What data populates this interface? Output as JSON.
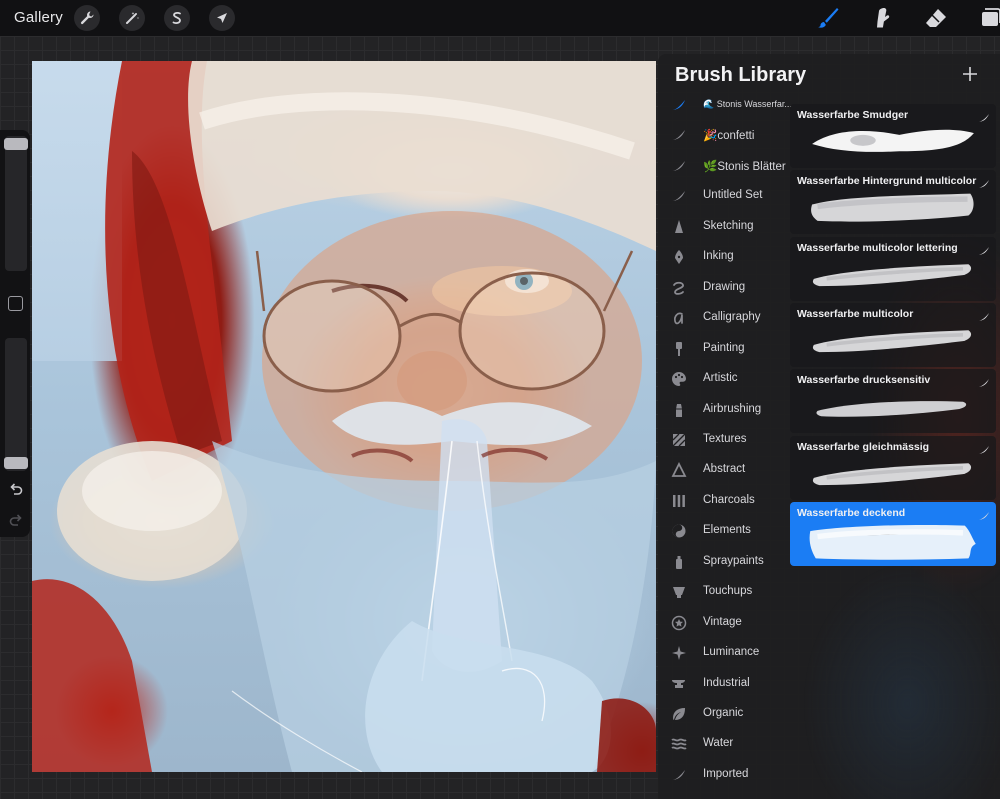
{
  "topbar": {
    "gallery_label": "Gallery",
    "left_tools": [
      {
        "name": "actions",
        "icon": "wrench-icon"
      },
      {
        "name": "adjustments",
        "icon": "magic-wand-icon"
      },
      {
        "name": "selection",
        "icon": "selection-s-icon"
      },
      {
        "name": "transform",
        "icon": "arrow-cursor-icon"
      }
    ],
    "right_tools": [
      {
        "name": "brush",
        "icon": "brush-icon",
        "active": true
      },
      {
        "name": "smudge",
        "icon": "smudge-finger-icon"
      },
      {
        "name": "eraser",
        "icon": "eraser-icon"
      },
      {
        "name": "layers",
        "icon": "layers-icon"
      }
    ],
    "accent_color": "#1b7df4"
  },
  "sidebar": {
    "size_slider_level": 0.02,
    "opacity_slider_level": 0.98,
    "modify_icon": "square-icon",
    "undo_icon": "undo-arrow-icon",
    "redo_icon": "redo-arrow-icon"
  },
  "panel": {
    "title": "Brush Library",
    "add_icon": "plus-icon",
    "sets": [
      {
        "label": "🌊 Stonis Wasserfar...",
        "icon": "brush-stroke-icon",
        "selected": true,
        "small": true
      },
      {
        "label": "🎉confetti",
        "icon": "brush-stroke-icon"
      },
      {
        "label": "🌿Stonis Blätter",
        "icon": "brush-stroke-icon"
      },
      {
        "label": "Untitled Set",
        "icon": "brush-stroke-icon"
      },
      {
        "label": "Sketching",
        "icon": "pencil-tip-icon"
      },
      {
        "label": "Inking",
        "icon": "ink-nib-icon"
      },
      {
        "label": "Drawing",
        "icon": "squiggle-icon"
      },
      {
        "label": "Calligraphy",
        "icon": "calligraphy-a-icon"
      },
      {
        "label": "Painting",
        "icon": "paint-brush-icon"
      },
      {
        "label": "Artistic",
        "icon": "palette-icon"
      },
      {
        "label": "Airbrushing",
        "icon": "airbrush-icon"
      },
      {
        "label": "Textures",
        "icon": "hatch-texture-icon"
      },
      {
        "label": "Abstract",
        "icon": "triangle-icon"
      },
      {
        "label": "Charcoals",
        "icon": "charcoal-bars-icon"
      },
      {
        "label": "Elements",
        "icon": "yin-yang-icon"
      },
      {
        "label": "Spraypaints",
        "icon": "spray-can-icon"
      },
      {
        "label": "Touchups",
        "icon": "touchup-cup-icon"
      },
      {
        "label": "Vintage",
        "icon": "star-circle-icon"
      },
      {
        "label": "Luminance",
        "icon": "sparkle-icon"
      },
      {
        "label": "Industrial",
        "icon": "anvil-icon"
      },
      {
        "label": "Organic",
        "icon": "leaf-icon"
      },
      {
        "label": "Water",
        "icon": "waves-icon"
      },
      {
        "label": "Imported",
        "icon": "brush-stroke-icon"
      }
    ],
    "brushes": [
      {
        "name": "Wasserfarbe Smudger",
        "selected": false,
        "stroke": "smudger"
      },
      {
        "name": "Wasserfarbe Hintergrund multicolor",
        "selected": false,
        "stroke": "wide"
      },
      {
        "name": "Wasserfarbe multicolor lettering",
        "selected": false,
        "stroke": "taper"
      },
      {
        "name": "Wasserfarbe multicolor",
        "selected": false,
        "stroke": "taper"
      },
      {
        "name": "Wasserfarbe drucksensitiv",
        "selected": false,
        "stroke": "thin"
      },
      {
        "name": "Wasserfarbe gleichmässig",
        "selected": false,
        "stroke": "taper"
      },
      {
        "name": "Wasserfarbe deckend",
        "selected": true,
        "stroke": "block"
      }
    ]
  }
}
